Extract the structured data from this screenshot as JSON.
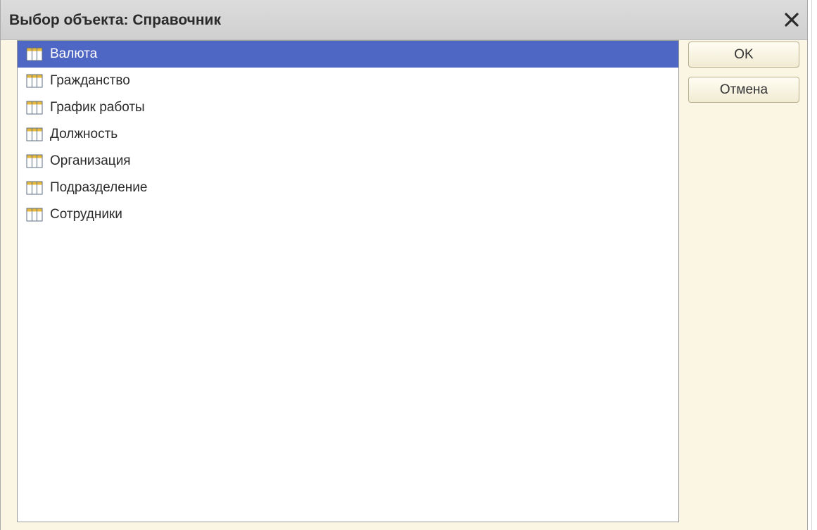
{
  "dialog": {
    "title": "Выбор объекта: Справочник",
    "close_icon": "close-icon"
  },
  "list": {
    "selected_index": 0,
    "item_icon": "catalog-table-icon",
    "items": [
      {
        "label": "Валюта"
      },
      {
        "label": "Гражданство"
      },
      {
        "label": "График работы"
      },
      {
        "label": "Должность"
      },
      {
        "label": "Организация"
      },
      {
        "label": "Подразделение"
      },
      {
        "label": "Сотрудники"
      }
    ]
  },
  "buttons": {
    "ok_label": "OK",
    "cancel_label": "Отмена"
  },
  "colors": {
    "selection": "#4e66c4",
    "dialog_background": "#fbf6e4",
    "titlebar": "#d4d4d4"
  }
}
